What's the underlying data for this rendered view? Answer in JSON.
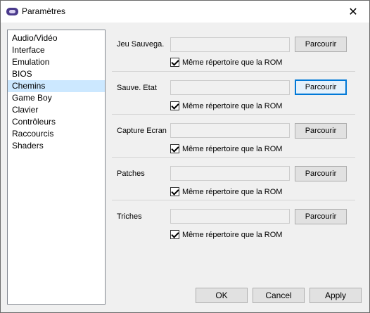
{
  "window": {
    "title": "Paramètres",
    "close_glyph": "✕"
  },
  "sidebar": {
    "items": [
      {
        "label": "Audio/Vidéo"
      },
      {
        "label": "Interface"
      },
      {
        "label": "Emulation"
      },
      {
        "label": "BIOS"
      },
      {
        "label": "Chemins",
        "selected": true
      },
      {
        "label": "Game Boy"
      },
      {
        "label": "Clavier"
      },
      {
        "label": "Contrôleurs"
      },
      {
        "label": "Raccourcis"
      },
      {
        "label": "Shaders"
      }
    ]
  },
  "paths": [
    {
      "label": "Jeu Sauvega.",
      "value": "",
      "browse_label": "Parcourir",
      "same_dir_label": "Même répertoire que la ROM",
      "same_dir_checked": true
    },
    {
      "label": "Sauve. Etat",
      "value": "",
      "browse_label": "Parcourir",
      "same_dir_label": "Même répertoire que la ROM",
      "same_dir_checked": true
    },
    {
      "label": "Capture Ecran",
      "value": "",
      "browse_label": "Parcourir",
      "same_dir_label": "Même répertoire que la ROM",
      "same_dir_checked": true
    },
    {
      "label": "Patches",
      "value": "",
      "browse_label": "Parcourir",
      "same_dir_label": "Même répertoire que la ROM",
      "same_dir_checked": true
    },
    {
      "label": "Triches",
      "value": "",
      "browse_label": "Parcourir",
      "same_dir_label": "Même répertoire que la ROM",
      "same_dir_checked": true
    }
  ],
  "footer": {
    "ok_label": "OK",
    "cancel_label": "Cancel",
    "apply_label": "Apply"
  },
  "colors": {
    "selection": "#cce8ff",
    "focus_border": "#0078d7"
  }
}
